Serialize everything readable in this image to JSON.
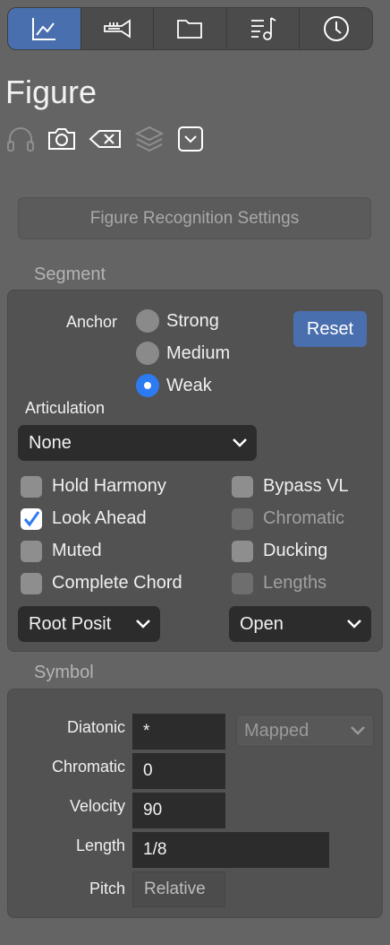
{
  "tabs": [
    {
      "icon": "line-chart-icon",
      "active": true
    },
    {
      "icon": "trumpet-icon",
      "active": false
    },
    {
      "icon": "folder-icon",
      "active": false
    },
    {
      "icon": "playlist-music-icon",
      "active": false
    },
    {
      "icon": "clock-icon",
      "active": false
    }
  ],
  "title": "Figure",
  "toolbar_icons": [
    "headphones-icon",
    "camera-icon",
    "delete-icon",
    "layers-icon",
    "dropdown-icon"
  ],
  "recognition_button": "Figure Recognition Settings",
  "segment": {
    "heading": "Segment",
    "anchor_label": "Anchor",
    "anchor_options": [
      "Strong",
      "Medium",
      "Weak"
    ],
    "anchor_selected": "Weak",
    "reset_label": "Reset",
    "articulation_label": "Articulation",
    "articulation_value": "None",
    "checks": {
      "hold_harmony": {
        "label": "Hold Harmony",
        "checked": false
      },
      "look_ahead": {
        "label": "Look Ahead",
        "checked": true
      },
      "muted": {
        "label": "Muted",
        "checked": false
      },
      "complete_chord": {
        "label": "Complete Chord",
        "checked": false
      },
      "bypass_vl": {
        "label": "Bypass VL",
        "checked": false
      },
      "chromatic": {
        "label": "Chromatic",
        "checked": false,
        "disabled": true
      },
      "ducking": {
        "label": "Ducking",
        "checked": false
      },
      "lengths": {
        "label": "Lengths",
        "checked": false,
        "disabled": true
      }
    },
    "position_select": "Root Posit",
    "voicing_select": "Open"
  },
  "symbol": {
    "heading": "Symbol",
    "diatonic_label": "Diatonic",
    "diatonic_value": "*",
    "mapped_select": "Mapped",
    "chromatic_label": "Chromatic",
    "chromatic_value": "0",
    "velocity_label": "Velocity",
    "velocity_value": "90",
    "length_label": "Length",
    "length_value": "1/8",
    "pitch_label": "Pitch",
    "pitch_value": "Relative"
  },
  "colors": {
    "accent": "#4a6fae",
    "check": "#2d7bf2",
    "background": "#646464"
  }
}
